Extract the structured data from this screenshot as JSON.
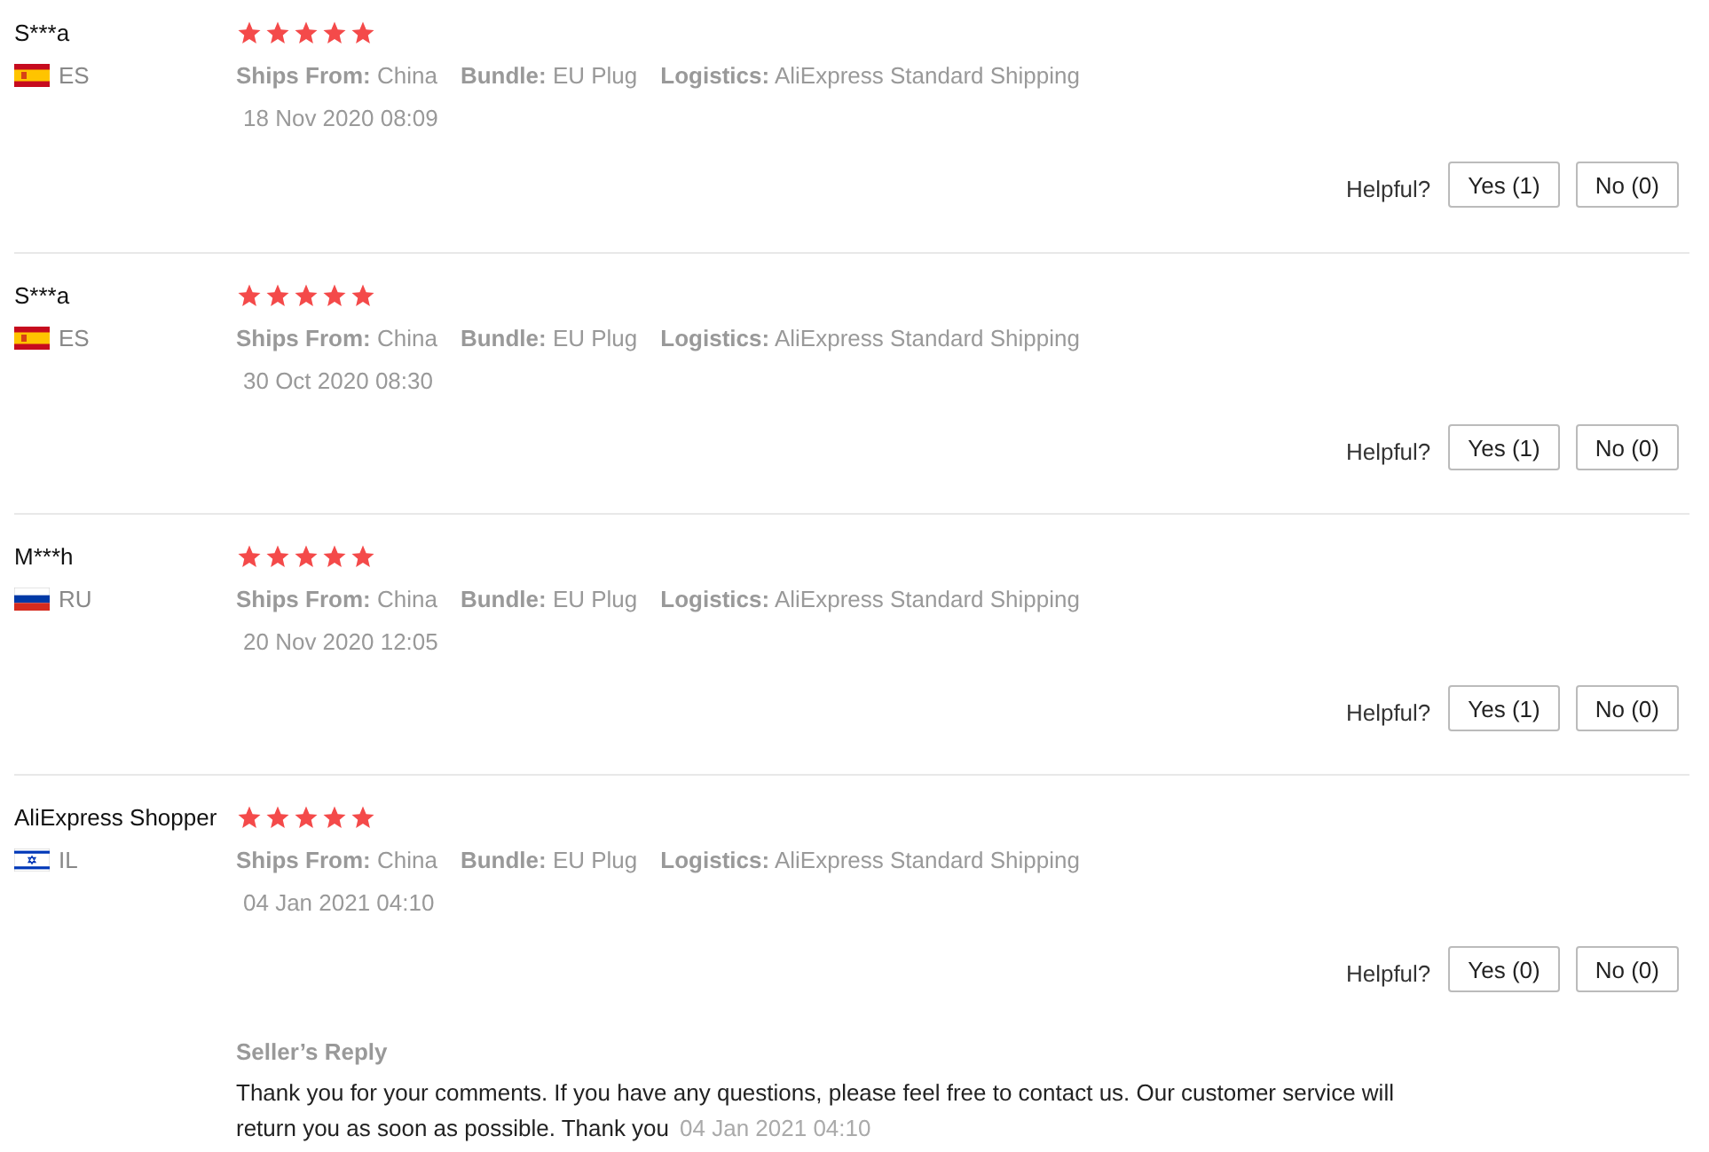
{
  "reviews": [
    {
      "name": "S***a",
      "country": {
        "kind": "es",
        "code": "ES"
      },
      "stars": 5,
      "ships_from": {
        "label": "Ships From:",
        "value": "China"
      },
      "bundle": {
        "label": "Bundle:",
        "value": "EU Plug"
      },
      "logistics": {
        "label": "Logistics:",
        "value": "AliExpress Standard Shipping"
      },
      "date": "18 Nov 2020 08:09",
      "helpful": "Helpful?",
      "yes": "Yes (1)",
      "no": "No (0)"
    },
    {
      "name": "S***a",
      "country": {
        "kind": "es",
        "code": "ES"
      },
      "stars": 5,
      "ships_from": {
        "label": "Ships From:",
        "value": "China"
      },
      "bundle": {
        "label": "Bundle:",
        "value": "EU Plug"
      },
      "logistics": {
        "label": "Logistics:",
        "value": "AliExpress Standard Shipping"
      },
      "date": "30 Oct 2020 08:30",
      "helpful": "Helpful?",
      "yes": "Yes (1)",
      "no": "No (0)"
    },
    {
      "name": "M***h",
      "country": {
        "kind": "ru",
        "code": "RU"
      },
      "stars": 5,
      "ships_from": {
        "label": "Ships From:",
        "value": "China"
      },
      "bundle": {
        "label": "Bundle:",
        "value": "EU Plug"
      },
      "logistics": {
        "label": "Logistics:",
        "value": "AliExpress Standard Shipping"
      },
      "date": "20 Nov 2020 12:05",
      "helpful": "Helpful?",
      "yes": "Yes (1)",
      "no": "No (0)"
    },
    {
      "name": "AliExpress Shopper",
      "country": {
        "kind": "il",
        "code": "IL"
      },
      "stars": 5,
      "ships_from": {
        "label": "Ships From:",
        "value": "China"
      },
      "bundle": {
        "label": "Bundle:",
        "value": "EU Plug"
      },
      "logistics": {
        "label": "Logistics:",
        "value": "AliExpress Standard Shipping"
      },
      "date": "04 Jan 2021 04:10",
      "helpful": "Helpful?",
      "yes": "Yes (0)",
      "no": "No (0)",
      "seller_reply": {
        "title": "Seller’s Reply",
        "text": "Thank you for your comments. If you have any questions, please feel free to contact us. Our customer service will return you as soon as possible. Thank you",
        "date": "04 Jan 2021 04:10"
      }
    }
  ]
}
